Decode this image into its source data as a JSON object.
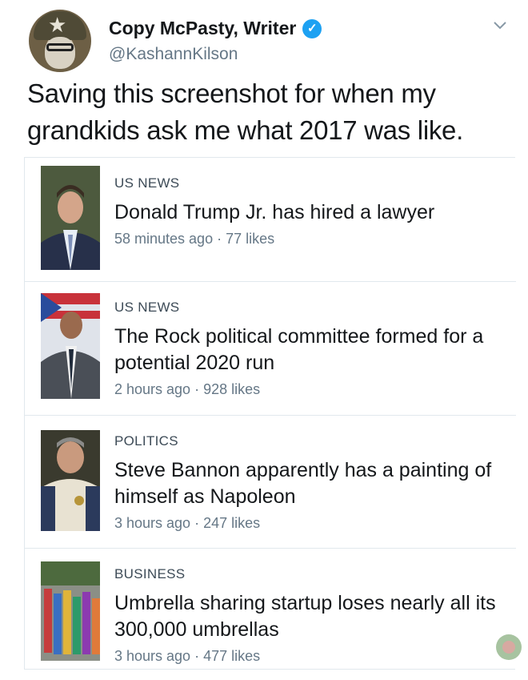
{
  "tweet": {
    "display_name": "Copy McPasty, Writer",
    "handle": "@KashannKilson",
    "text": "Saving this screenshot for when my grandkids ask me what 2017 was like."
  },
  "stories": [
    {
      "category": "US NEWS",
      "headline": "Donald Trump Jr. has hired a lawyer",
      "time": "58 minutes ago",
      "likes": "77 likes"
    },
    {
      "category": "US NEWS",
      "headline": "The Rock political committee formed for a potential 2020 run",
      "time": "2 hours ago",
      "likes": "928 likes"
    },
    {
      "category": "POLITICS",
      "headline": "Steve Bannon apparently has a painting of himself as Napoleon",
      "time": "3 hours ago",
      "likes": "247 likes"
    },
    {
      "category": "BUSINESS",
      "headline": "Umbrella sharing startup loses nearly all its 300,000 umbrellas",
      "time": "3 hours ago",
      "likes": "477 likes"
    }
  ],
  "icons": {
    "verified": "verified-badge-icon",
    "menu": "chevron-down-icon"
  },
  "colors": {
    "verified_blue": "#1da1f2",
    "meta_gray": "#657786"
  }
}
